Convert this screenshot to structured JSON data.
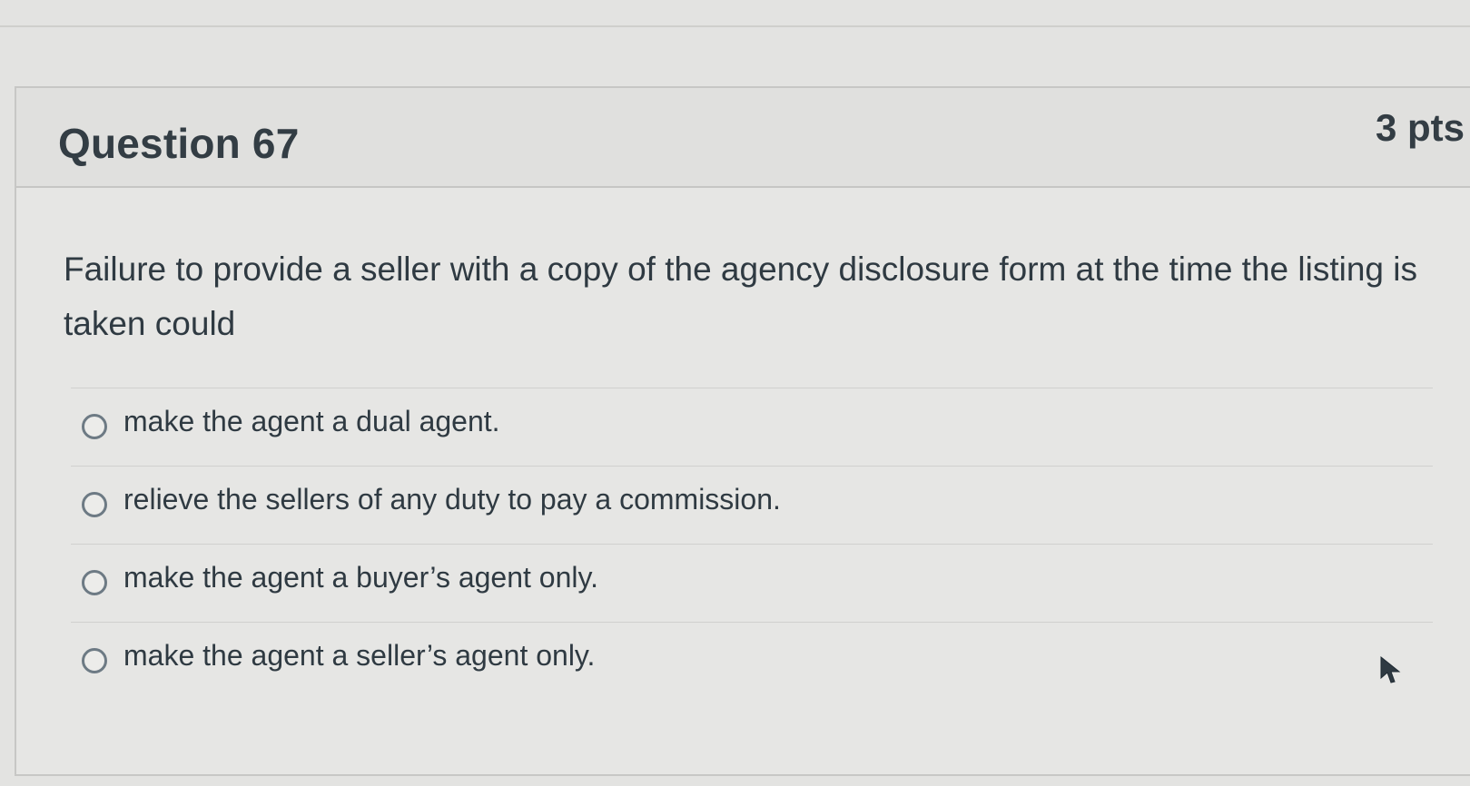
{
  "question": {
    "title": "Question 67",
    "points": "3 pts",
    "text": "Failure to provide a seller with a copy of the agency disclosure form at the time the listing is taken could",
    "answers": [
      {
        "label": "make the agent a dual agent.",
        "selected": false
      },
      {
        "label": "relieve the sellers of any duty to pay a commission.",
        "selected": false
      },
      {
        "label": "make the agent a buyer’s agent only.",
        "selected": false
      },
      {
        "label": "make the agent a seller’s agent only.",
        "selected": false
      }
    ]
  },
  "icons": {
    "radio": "radio-button-empty",
    "cursor": "mouse-pointer-arrow"
  }
}
